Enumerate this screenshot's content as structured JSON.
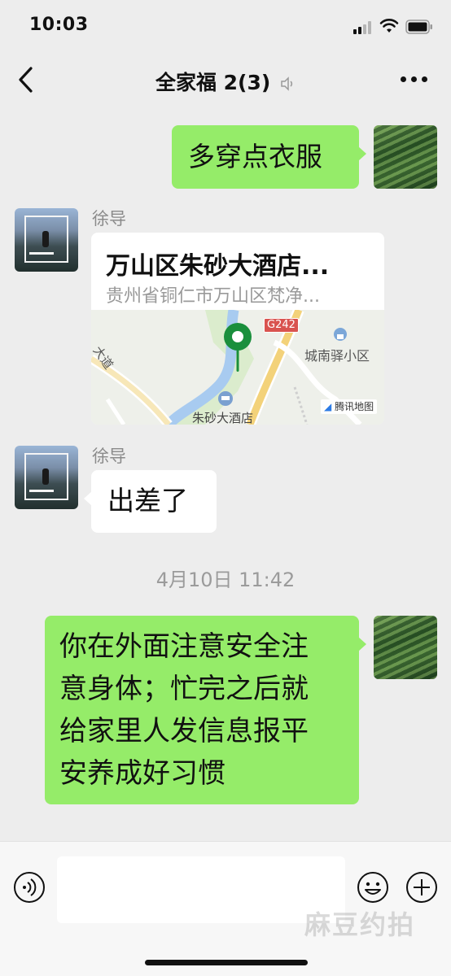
{
  "status_bar": {
    "time": "10:03"
  },
  "nav": {
    "title": "全家福 2(3)"
  },
  "messages": {
    "m1": {
      "text": "多穿点衣服"
    },
    "m2": {
      "sender": "徐导",
      "location_name": "万山区朱砂大酒店...",
      "location_address": "贵州省铜仁市万山区梵净...",
      "map": {
        "road_label_left": "大道",
        "highway_badge": "G242",
        "poi_label": "城南驿小区",
        "hotel_label": "朱砂大酒店",
        "provider": "腾讯地图"
      }
    },
    "m3": {
      "sender": "徐导",
      "text": "出差了"
    },
    "timestamp": "4月10日 11:42",
    "m4": {
      "lines": [
        "你在外面注意安全注",
        "意身体；忙完之后就",
        "给家里人发信息报平",
        "安养成好习惯"
      ]
    }
  },
  "input": {
    "value": "",
    "placeholder": ""
  },
  "watermark": "麻豆约拍",
  "colors": {
    "bubble_self": "#95ec69",
    "bubble_other": "#ffffff",
    "background": "#ededed",
    "map_pin": "#1a8f3c"
  }
}
